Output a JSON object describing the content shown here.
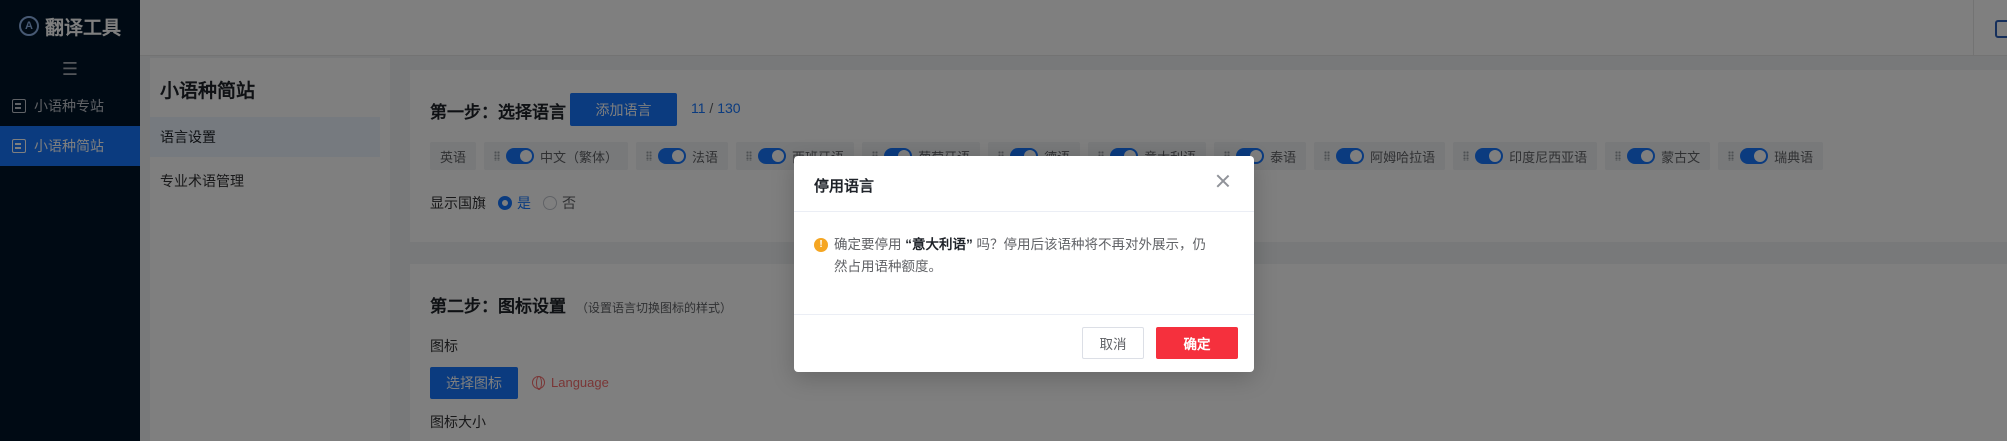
{
  "app": {
    "title": "翻译工具",
    "logo_letter": "A"
  },
  "sidebar": {
    "collapse_icon": "menu-fold-icon",
    "items": [
      {
        "label": "小语种专站",
        "active": false
      },
      {
        "label": "小语种简站",
        "active": true
      }
    ]
  },
  "submenu": {
    "title": "小语种简站",
    "items": [
      {
        "label": "语言设置",
        "active": true
      },
      {
        "label": "专业术语管理",
        "active": false
      }
    ]
  },
  "step1": {
    "title": "第一步：选择语言",
    "add_button": "添加语言",
    "count_used": "11",
    "count_sep": " / ",
    "count_total": "130",
    "languages": [
      {
        "label": "英语",
        "toggle": false
      },
      {
        "label": "中文（繁体）",
        "toggle": true
      },
      {
        "label": "法语",
        "toggle": true
      },
      {
        "label": "西班牙语",
        "toggle": true
      },
      {
        "label": "葡萄牙语",
        "toggle": true
      },
      {
        "label": "德语",
        "toggle": true
      },
      {
        "label": "意大利语",
        "toggle": true
      },
      {
        "label": "泰语",
        "toggle": true
      },
      {
        "label": "阿姆哈拉语",
        "toggle": true
      },
      {
        "label": "印度尼西亚语",
        "toggle": true
      },
      {
        "label": "蒙古文",
        "toggle": true
      },
      {
        "label": "瑞典语",
        "toggle": true
      }
    ],
    "flag_label": "显示国旗",
    "flag_yes": "是",
    "flag_no": "否"
  },
  "step2": {
    "title": "第二步：图标设置",
    "hint": "（设置语言切换图标的样式）",
    "icon_label": "图标",
    "choose_button": "选择图标",
    "preview_text": "Language",
    "size_label": "图标大小"
  },
  "dialog": {
    "title": "停用语言",
    "msg_before": "确定要停用 ",
    "msg_lang": "“意大利语”",
    "msg_after": " 吗？停用后该语种将不再对外展示，仍然占用语种额度。",
    "cancel": "取消",
    "confirm": "确定"
  },
  "colors": {
    "primary": "#1677ff",
    "danger": "#f5303d",
    "sidebar": "#001529",
    "warning": "#f5a623"
  }
}
